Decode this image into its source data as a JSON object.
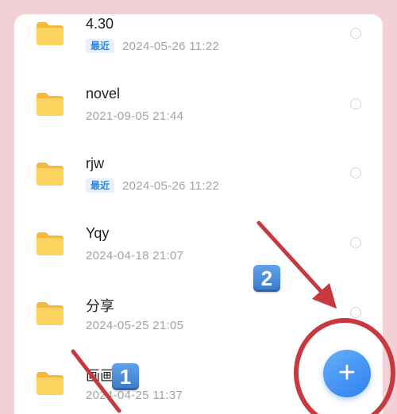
{
  "files": [
    {
      "name": "4.30",
      "badge": "最近",
      "date": "2024-05-26  11:22"
    },
    {
      "name": "novel",
      "badge": "",
      "date": "2021-09-05  21:44"
    },
    {
      "name": "rjw",
      "badge": "最近",
      "date": "2024-05-26  11:22"
    },
    {
      "name": "Yqy",
      "badge": "",
      "date": "2024-04-18  21:07"
    },
    {
      "name": "分享",
      "badge": "",
      "date": "2024-05-25  21:05"
    },
    {
      "name": "画画",
      "badge": "",
      "date": "2024-04-25  11:37"
    }
  ],
  "fab": {
    "label": "+"
  },
  "annotations": {
    "marker_1": "1",
    "marker_2": "2"
  },
  "colors": {
    "background": "#f2d0d6",
    "folder": "#f7c94b",
    "badge_text": "#3b84d6",
    "fab": "#3f8ff3",
    "arrow": "#c8383f"
  }
}
